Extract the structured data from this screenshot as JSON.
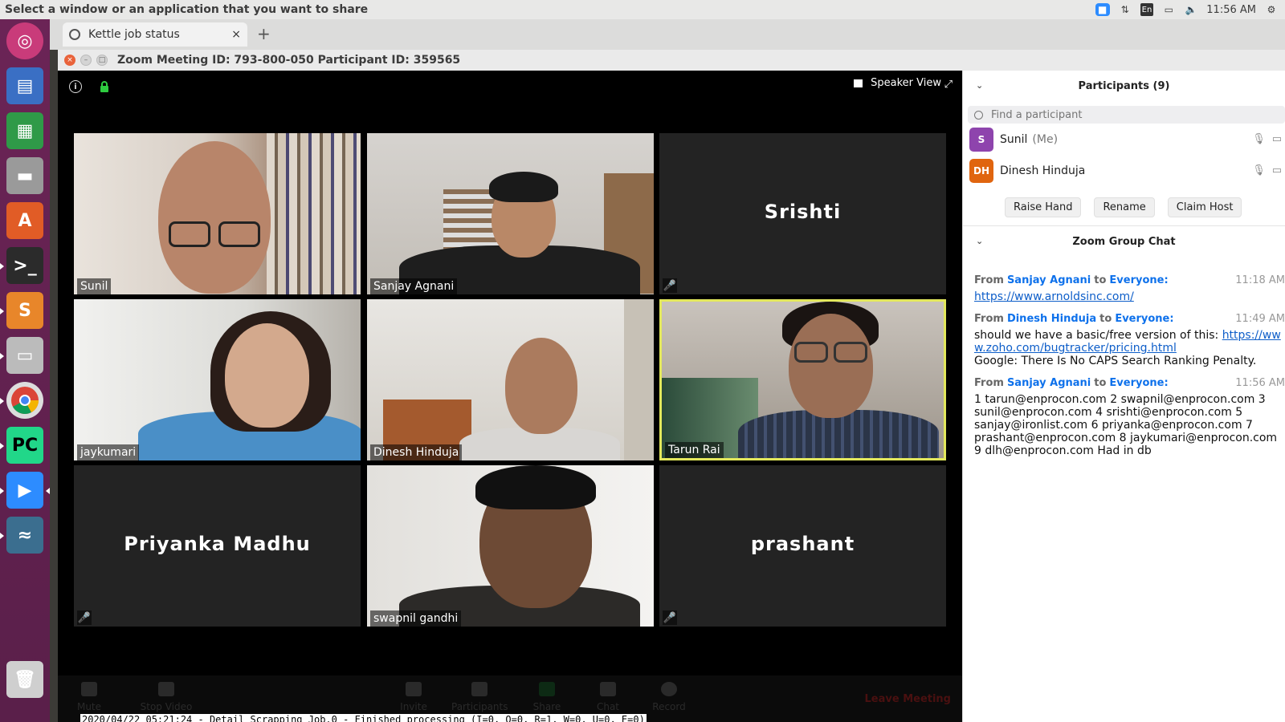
{
  "system_bar": {
    "prompt": "Select a window or an application that you want to share",
    "keyboard": "En",
    "clock": "11:56 AM"
  },
  "browser": {
    "tab_title": "Kettle job status",
    "close_glyph": "×",
    "new_tab_glyph": "+"
  },
  "zoom_window": {
    "title": "Zoom Meeting ID: 793-800-050 Participant ID: 359565"
  },
  "video": {
    "view_mode": "Speaker View",
    "tiles": [
      {
        "name": "Sunil",
        "video": true,
        "muted": false
      },
      {
        "name": "Sanjay Agnani",
        "video": true,
        "muted": false
      },
      {
        "name": "Srishti",
        "video": false,
        "muted": true
      },
      {
        "name": "jaykumari",
        "video": true,
        "muted": false
      },
      {
        "name": "Dinesh Hinduja",
        "video": true,
        "muted": false
      },
      {
        "name": "Tarun Rai",
        "video": true,
        "muted": false,
        "active_speaker": true
      },
      {
        "name": "Priyanka Madhu",
        "video": false,
        "muted": true
      },
      {
        "name": "swapnil gandhi",
        "video": true,
        "muted": false
      },
      {
        "name": "prashant",
        "video": false,
        "muted": true
      }
    ]
  },
  "toolbar": {
    "mute": "Mute",
    "stop_video": "Stop Video",
    "invite": "Invite",
    "participants": "Participants",
    "participants_count": "9",
    "share": "Share",
    "chat": "Chat",
    "record": "Record",
    "leave": "Leave Meeting"
  },
  "log_line": "2020/04/22 05:21:24 - Detail Scrapping Job.0 - Finished processing (I=0, O=0, R=1, W=0, U=0, E=0)",
  "participants_panel": {
    "title": "Participants (9)",
    "search_placeholder": "Find a participant",
    "list": [
      {
        "initials": "S",
        "name": "Sunil",
        "suffix": "(Me)",
        "color": "#8e44ad"
      },
      {
        "initials": "DH",
        "name": "Dinesh Hinduja",
        "suffix": "",
        "color": "#e0650f"
      }
    ],
    "buttons": {
      "raise_hand": "Raise Hand",
      "rename": "Rename",
      "claim_host": "Claim Host"
    }
  },
  "chat_panel": {
    "title": "Zoom Group Chat",
    "messages": [
      {
        "from_label": "From",
        "sender": "Sanjay Agnani",
        "to_label": "to",
        "recipient": "Everyone:",
        "time": "11:18 AM",
        "link": "https://www.arnoldsinc.com/",
        "text": ""
      },
      {
        "from_label": "From",
        "sender": "Dinesh Hinduja",
        "to_label": "to",
        "recipient": "Everyone:",
        "time": "11:49 AM",
        "text_before": "should we have a basic/free version of this: ",
        "link": "https://www.zoho.com/bugtracker/pricing.html",
        "text": "Google: There Is No CAPS Search Ranking Penalty."
      },
      {
        "from_label": "From",
        "sender": "Sanjay Agnani",
        "to_label": "to",
        "recipient": "Everyone:",
        "time": "11:56 AM",
        "text": "1 tarun@enprocon.com 2 swapnil@enprocon.com 3 sunil@enprocon.com 4 srishti@enprocon.com 5 sanjay@ironlist.com 6 priyanka@enprocon.com 7 prashant@enprocon.com 8 jaykumari@enprocon.com 9 dlh@enprocon.com Had in db"
      }
    ]
  },
  "colors": {
    "zoom_blue": "#2d8cff",
    "active_border": "#e3e85c",
    "muted_red": "#e2453c",
    "launcher": "#5a1f4a"
  }
}
